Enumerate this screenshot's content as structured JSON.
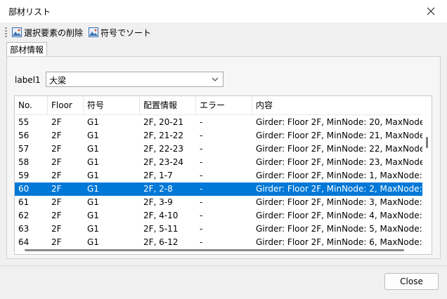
{
  "window": {
    "title": "部材リスト"
  },
  "toolbar": {
    "delete_label": "選択要素の削除",
    "sort_label": "符号でソート"
  },
  "tabs": [
    {
      "label": "部材情報"
    }
  ],
  "filter": {
    "label": "label1",
    "selected": "大梁"
  },
  "table": {
    "columns": [
      "No.",
      "Floor",
      "符号",
      "配置情報",
      "エラー",
      "内容"
    ],
    "rows": [
      [
        "55",
        "2F",
        "G1",
        "2F, 20-21",
        "-",
        "Girder: Floor 2F, MinNode: 20, MaxNode"
      ],
      [
        "56",
        "2F",
        "G1",
        "2F, 21-22",
        "-",
        "Girder: Floor 2F, MinNode: 21, MaxNode"
      ],
      [
        "57",
        "2F",
        "G1",
        "2F, 22-23",
        "-",
        "Girder: Floor 2F, MinNode: 22, MaxNode"
      ],
      [
        "58",
        "2F",
        "G1",
        "2F, 23-24",
        "-",
        "Girder: Floor 2F, MinNode: 23, MaxNode"
      ],
      [
        "59",
        "2F",
        "G1",
        "2F, 1-7",
        "-",
        "Girder: Floor 2F, MinNode: 1, MaxNode:"
      ],
      [
        "60",
        "2F",
        "G1",
        "2F, 2-8",
        "-",
        "Girder: Floor 2F, MinNode: 2, MaxNode:"
      ],
      [
        "61",
        "2F",
        "G1",
        "2F, 3-9",
        "-",
        "Girder: Floor 2F, MinNode: 3, MaxNode:"
      ],
      [
        "62",
        "2F",
        "G1",
        "2F, 4-10",
        "-",
        "Girder: Floor 2F, MinNode: 4, MaxNode:"
      ],
      [
        "63",
        "2F",
        "G1",
        "2F, 5-11",
        "-",
        "Girder: Floor 2F, MinNode: 5, MaxNode:"
      ],
      [
        "64",
        "2F",
        "G1",
        "2F, 6-12",
        "-",
        "Girder: Floor 2F, MinNode: 6, MaxNode:"
      ]
    ],
    "selected_row": 5
  },
  "footer": {
    "close_label": "Close"
  },
  "colors": {
    "selection": "#0078d7",
    "window_bg": "#f0f0f0"
  }
}
